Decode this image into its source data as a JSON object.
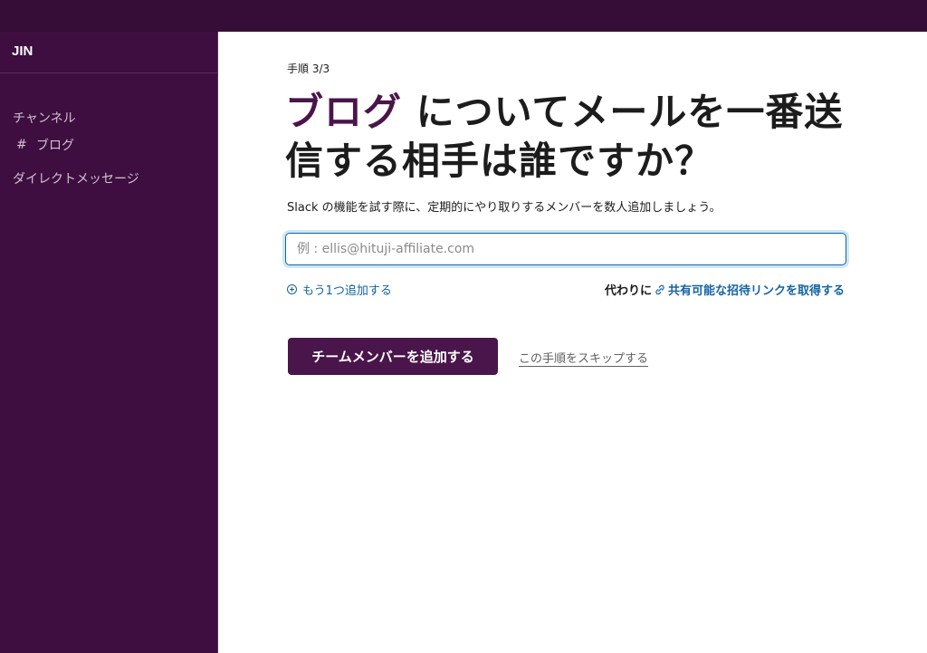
{
  "sidebar": {
    "workspace_name": "JIN",
    "channels_label": "チャンネル",
    "channel_hash": "#",
    "channel_name": "ブログ",
    "dm_label": "ダイレクトメッセージ"
  },
  "main": {
    "step": "手順 3/3",
    "title_accent": "ブログ",
    "title_rest": " についてメールを一番送信する相手は誰ですか？",
    "description": "Slack の機能を試す際に、定期的にやり取りするメンバーを数人追加しましょう。",
    "email_placeholder": "例 : ellis@hituji-affiliate.com",
    "email_value": "",
    "add_more_label": "もう1つ追加する",
    "share_prefix": "代わりに",
    "share_link_label": "共有可能な招待リンクを取得する",
    "primary_button_label": "チームメンバーを追加する",
    "skip_label": "この手順をスキップする"
  },
  "colors": {
    "topbar": "#350d36",
    "sidebar": "#3f0e40",
    "accent": "#4a154b",
    "link": "#1264a3"
  }
}
